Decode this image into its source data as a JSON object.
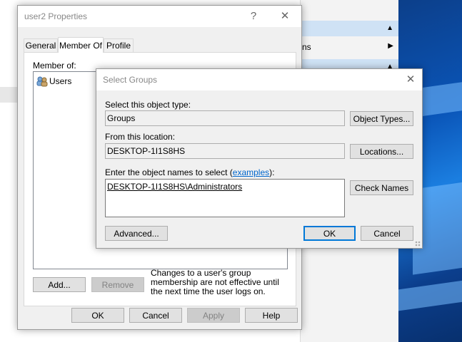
{
  "background": {
    "menu_row_label": "ns"
  },
  "properties_dialog": {
    "title": "user2 Properties",
    "help_glyph": "?",
    "close_glyph": "✕",
    "tabs": [
      "General",
      "Member Of",
      "Profile"
    ],
    "member_of_label": "Member of:",
    "members": [
      "Users"
    ],
    "add_label": "Add...",
    "remove_label": "Remove",
    "note": "Changes to a user's group membership are not effective until the next time the user logs on.",
    "ok_label": "OK",
    "cancel_label": "Cancel",
    "apply_label": "Apply",
    "help_label": "Help"
  },
  "select_groups_dialog": {
    "title": "Select Groups",
    "close_glyph": "✕",
    "object_type_label": "Select this object type:",
    "object_type_value": "Groups",
    "object_types_button": "Object Types...",
    "location_label": "From this location:",
    "location_value": "DESKTOP-1I1S8HS",
    "locations_button": "Locations...",
    "names_label_prefix": "Enter the object names to select (",
    "names_label_link": "examples",
    "names_label_suffix": "):",
    "names_value": "DESKTOP-1I1S8HS\\Administrators",
    "check_names_button": "Check Names",
    "advanced_button": "Advanced...",
    "ok_label": "OK",
    "cancel_label": "Cancel"
  },
  "colors": {
    "link": "#0066cc",
    "default_button_border": "#0078d7",
    "dialog_bg": "#f0f0f0"
  }
}
